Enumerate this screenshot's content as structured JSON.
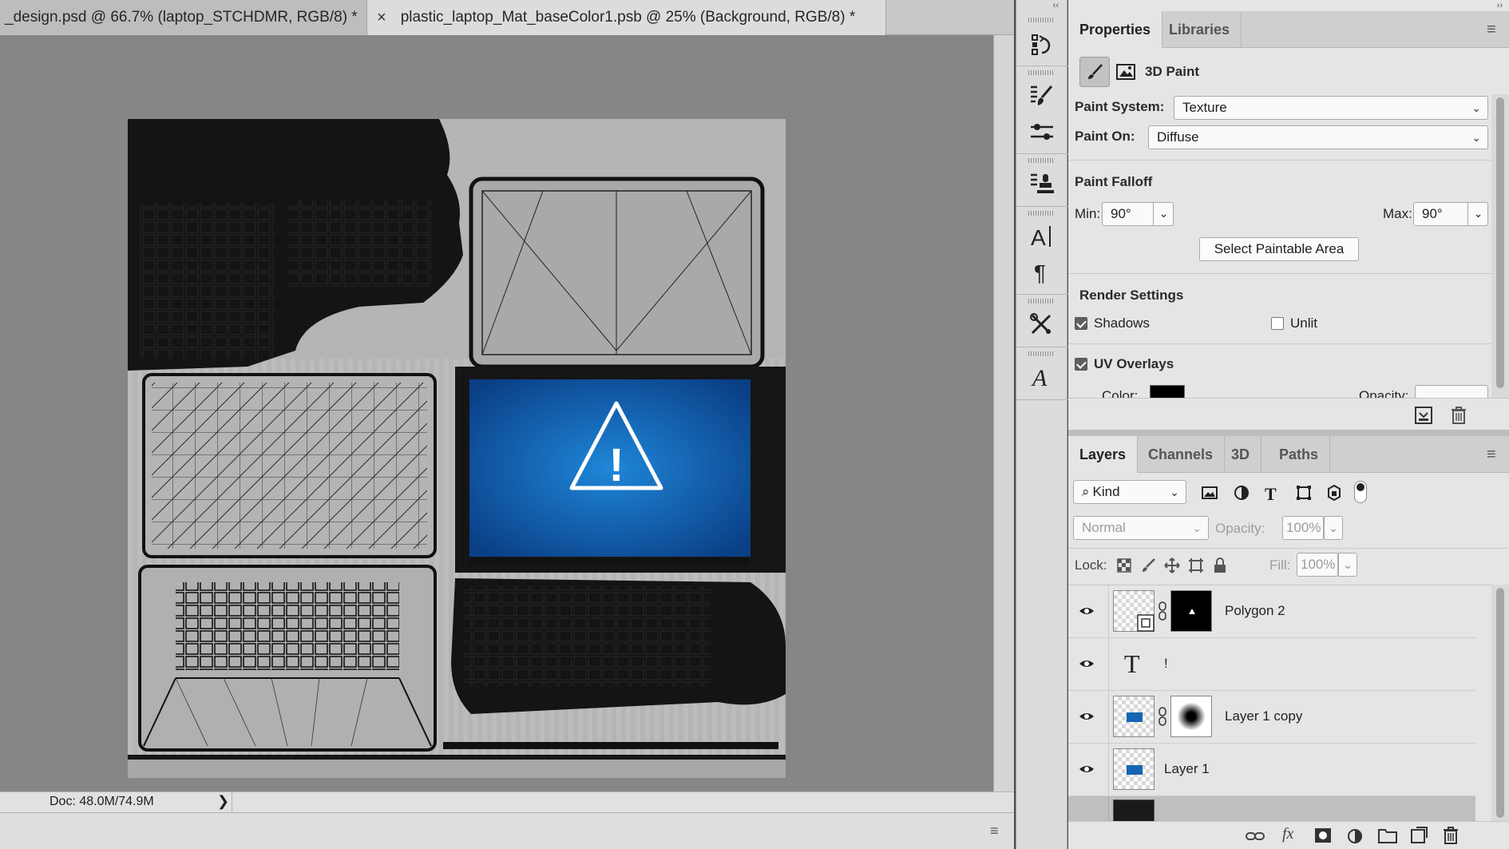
{
  "document": {
    "tabs": [
      {
        "title": "_design.psd @ 66.7% (laptop_STCHDMR, RGB/8) *"
      },
      {
        "title": "plastic_laptop_Mat_baseColor1.psb @ 25% (Background, RGB/8) *"
      }
    ],
    "close_glyph": "×",
    "status": "Doc: 48.0M/74.9M",
    "status_arrow": "❯"
  },
  "texture_glyph": "!",
  "toolstrip": {
    "icons": [
      "history-icon",
      "brush-preset-icon",
      "adjust-icon",
      "clone-source-icon",
      "character-icon",
      "paragraph-icon",
      "tool-presets-icon",
      "glyphs-icon"
    ]
  },
  "properties": {
    "tabs": [
      "Properties",
      "Libraries"
    ],
    "title": "3D Paint",
    "paint_system_label": "Paint System:",
    "paint_system_value": "Texture",
    "paint_on_label": "Paint On:",
    "paint_on_value": "Diffuse",
    "falloff_title": "Paint Falloff",
    "min_label": "Min:",
    "min_value": "90°",
    "max_label": "Max:",
    "max_value": "90°",
    "select_button": "Select Paintable Area",
    "render_title": "Render Settings",
    "shadows_label": "Shadows",
    "shadows_checked": true,
    "unlit_label": "Unlit",
    "unlit_checked": false,
    "uv_label": "UV Overlays",
    "uv_checked": true,
    "color_label": "Color:",
    "opacity_label": "Opacity:",
    "uv_color": "#000000"
  },
  "layers": {
    "tabs": [
      "Layers",
      "Channels",
      "3D",
      "Paths"
    ],
    "kind_label": "Kind",
    "blend_mode": "Normal",
    "opacity_label": "Opacity:",
    "opacity_value": "100%",
    "lock_label": "Lock:",
    "fill_label": "Fill:",
    "fill_value": "100%",
    "items": [
      {
        "name": "Polygon 2",
        "type": "shape"
      },
      {
        "name": "!",
        "type": "text"
      },
      {
        "name": "Layer 1 copy",
        "type": "masked"
      },
      {
        "name": "Layer 1",
        "type": "pixel"
      }
    ]
  },
  "colors": {
    "accent_blue": "#1565b4",
    "panel_bg": "#e5e5e5",
    "canvas_bg": "#868686"
  }
}
